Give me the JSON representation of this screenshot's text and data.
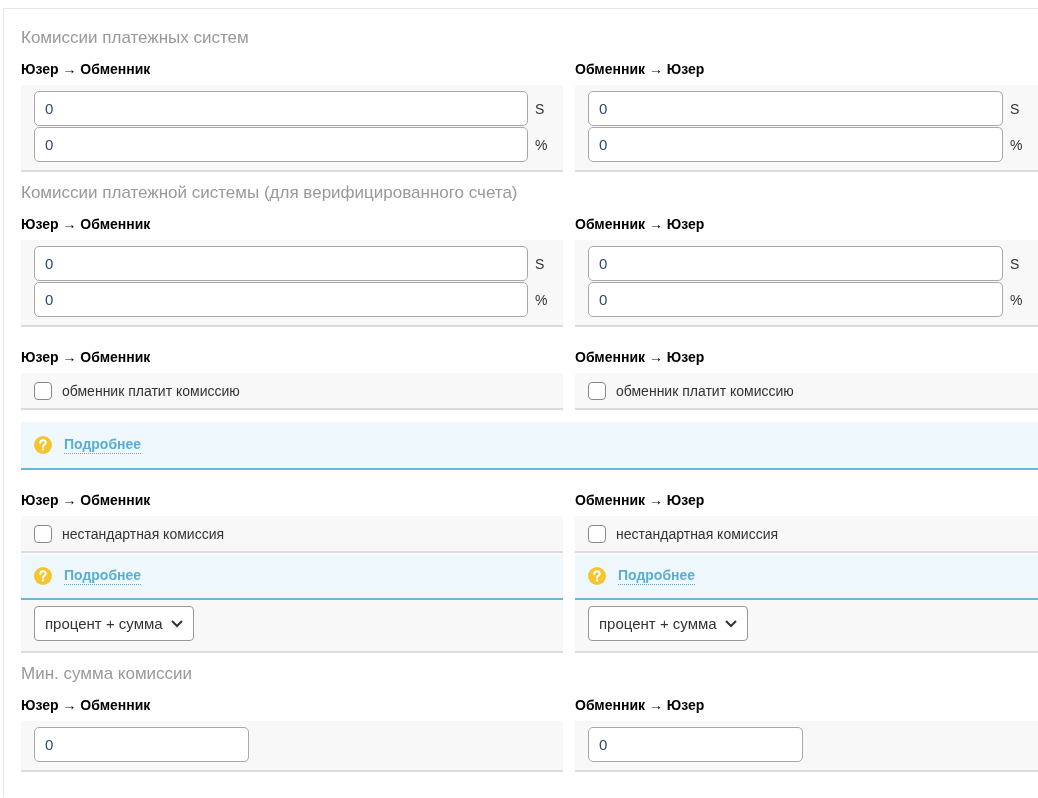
{
  "blocks": [
    {
      "kind": "title",
      "text": "Комиссии платежных систем"
    },
    {
      "kind": "columns",
      "columns": [
        {
          "label": "Юзер → Обменник",
          "cells": [
            {
              "kind": "amounts",
              "fields": [
                {
                  "value": "0",
                  "unit": "S"
                },
                {
                  "value": "0",
                  "unit": "%"
                }
              ]
            }
          ]
        },
        {
          "label": "Обменник → Юзер",
          "cells": [
            {
              "kind": "amounts",
              "fields": [
                {
                  "value": "0",
                  "unit": "S"
                },
                {
                  "value": "0",
                  "unit": "%"
                }
              ]
            }
          ]
        }
      ]
    },
    {
      "kind": "title",
      "text": "Комиссии платежной системы (для верифицированного счета)"
    },
    {
      "kind": "columns",
      "columns": [
        {
          "label": "Юзер → Обменник",
          "cells": [
            {
              "kind": "amounts",
              "fields": [
                {
                  "value": "0",
                  "unit": "S"
                },
                {
                  "value": "0",
                  "unit": "%"
                }
              ]
            }
          ]
        },
        {
          "label": "Обменник → Юзер",
          "cells": [
            {
              "kind": "amounts",
              "fields": [
                {
                  "value": "0",
                  "unit": "S"
                },
                {
                  "value": "0",
                  "unit": "%"
                }
              ]
            }
          ]
        }
      ]
    },
    {
      "kind": "columns",
      "columns": [
        {
          "label": "Юзер → Обменник",
          "cells": [
            {
              "kind": "checkbox",
              "label": "обменник платит комиссию",
              "checked": false
            }
          ]
        },
        {
          "label": "Обменник → Юзер",
          "cells": [
            {
              "kind": "checkbox",
              "label": "обменник платит комиссию",
              "checked": false
            }
          ]
        }
      ]
    },
    {
      "kind": "info",
      "link": "Подробнее"
    },
    {
      "kind": "columns",
      "columns": [
        {
          "label": "Юзер → Обменник",
          "cells": [
            {
              "kind": "checkbox",
              "label": "нестандартная комиссия",
              "checked": false
            },
            {
              "kind": "info",
              "link": "Подробнее"
            },
            {
              "kind": "select",
              "value": "процент + сумма"
            }
          ]
        },
        {
          "label": "Обменник → Юзер",
          "cells": [
            {
              "kind": "checkbox",
              "label": "нестандартная комиссия",
              "checked": false
            },
            {
              "kind": "info",
              "link": "Подробнее"
            },
            {
              "kind": "select",
              "value": "процент + сумма"
            }
          ]
        }
      ]
    },
    {
      "kind": "title",
      "text": "Мин. сумма комиссии"
    },
    {
      "kind": "columns",
      "columns": [
        {
          "label": "Юзер → Обменник",
          "cells": [
            {
              "kind": "input",
              "value": "0"
            }
          ]
        },
        {
          "label": "Обменник → Юзер",
          "cells": [
            {
              "kind": "input",
              "value": "0"
            }
          ]
        }
      ]
    }
  ]
}
